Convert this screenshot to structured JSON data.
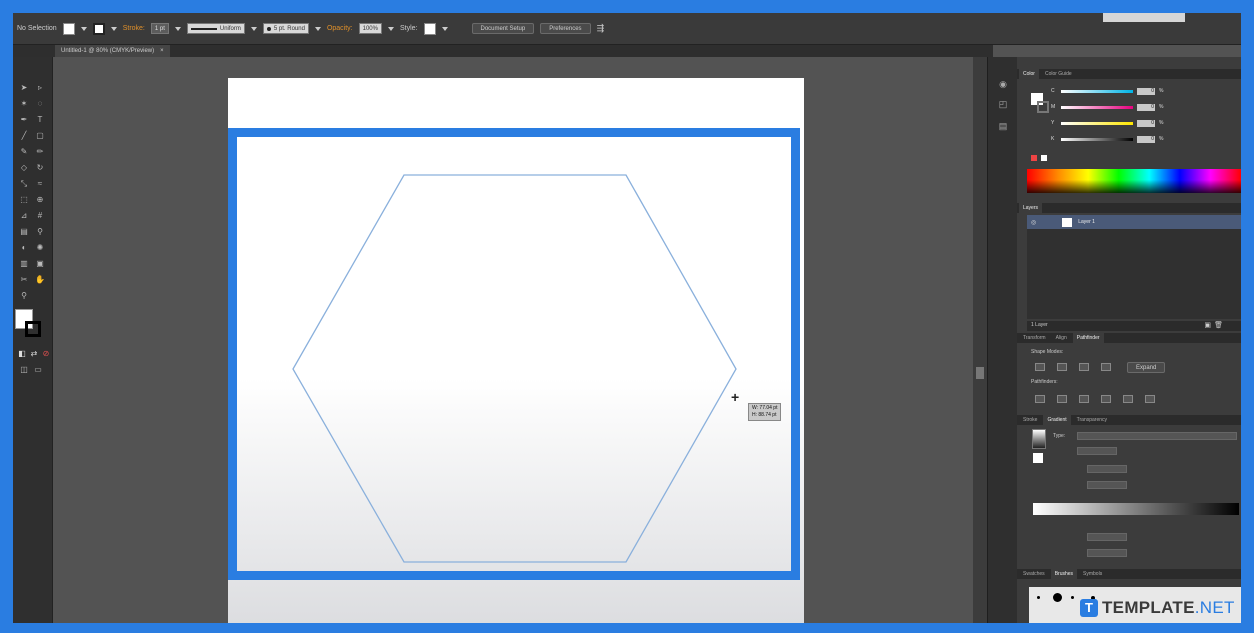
{
  "colors": {
    "frame_blue": "#2a7de1",
    "canvas_gray": "#535353",
    "panel_dark": "#3c3c3c",
    "hexagon_stroke": "#8ab0dc"
  },
  "control_bar": {
    "selection_label": "No Selection",
    "stroke_label": "Stroke:",
    "stroke_value": "1 pt",
    "profile_value": "Uniform",
    "brush_value": "5 pt. Round",
    "opacity_label": "Opacity:",
    "opacity_value": "100%",
    "style_label": "Style:",
    "document_setup": "Document Setup",
    "preferences": "Preferences"
  },
  "document_tab": {
    "title": "Untitled-1 @ 80% (CMYK/Preview)",
    "close_icon": "close-icon"
  },
  "toolbox": {
    "icons": [
      "selection-tool-icon",
      "direct-selection-tool-icon",
      "magic-wand-icon",
      "lasso-icon",
      "pen-tool-icon",
      "type-tool-icon",
      "line-tool-icon",
      "rectangle-tool-icon",
      "paintbrush-icon",
      "pencil-icon",
      "eraser-icon",
      "rotate-icon",
      "scale-icon",
      "warp-icon",
      "free-transform-icon",
      "shape-builder-icon",
      "perspective-icon",
      "mesh-icon",
      "gradient-icon",
      "eyedropper-icon",
      "blend-icon",
      "symbol-sprayer-icon",
      "graph-icon",
      "artboard-icon",
      "slice-icon",
      "hand-icon",
      "zoom-icon"
    ]
  },
  "canvas": {
    "readout_line1": "W: 77.04 pt",
    "readout_line2": "H: 88.74 pt"
  },
  "color_panel": {
    "tabs": [
      "Color",
      "Color Guide"
    ],
    "channels": [
      {
        "label": "C",
        "value": "0",
        "unit": "%",
        "color": "#00b4e6"
      },
      {
        "label": "M",
        "value": "0",
        "unit": "%",
        "color": "#e6007e"
      },
      {
        "label": "Y",
        "value": "0",
        "unit": "%",
        "color": "#ffe600"
      },
      {
        "label": "K",
        "value": "0",
        "unit": "%",
        "color": "#000000"
      }
    ]
  },
  "layers_panel": {
    "tab": "Layers",
    "layer_name": "Layer 1",
    "footer": "1 Layer"
  },
  "pathfinder_panel": {
    "tabs": [
      "Transform",
      "Align",
      "Pathfinder"
    ],
    "shape_modes_label": "Shape Modes:",
    "expand_label": "Expand",
    "pathfinders_label": "Pathfinders:"
  },
  "gradient_panel": {
    "tabs": [
      "Stroke",
      "Gradient",
      "Transparency"
    ],
    "type_label": "Type:"
  },
  "bottom_panel": {
    "tabs": [
      "Swatches",
      "Brushes",
      "Symbols"
    ]
  },
  "watermark": {
    "icon_letter": "T",
    "brand": "TEMPLATE",
    "suffix": ".NET"
  }
}
